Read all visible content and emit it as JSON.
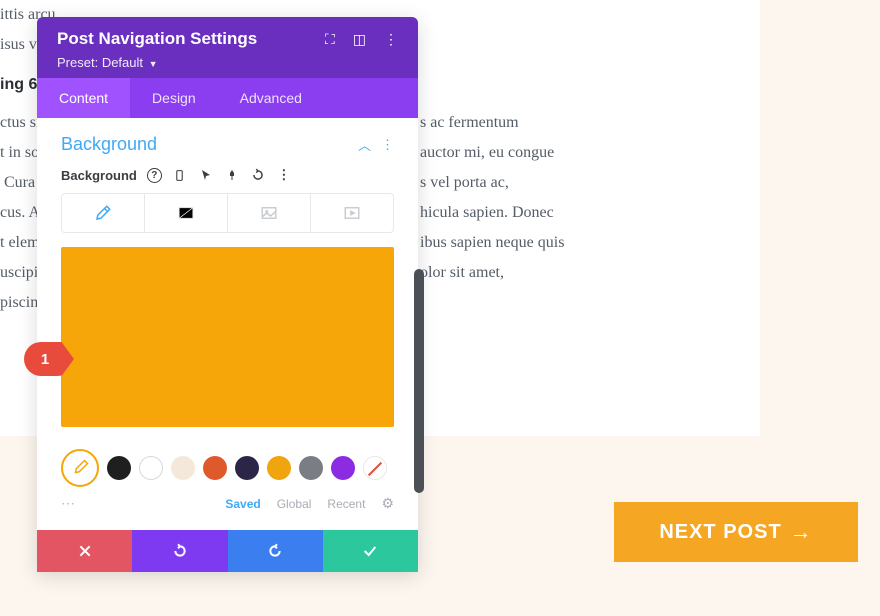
{
  "bg_text_top": "ittis arcu.\nisus velit",
  "bg_heading": "ing 6",
  "bg_text_body": "ctus sin\nt in so\n Cura\ncus. A\nt elem\nuscipi\npiscin",
  "bg_text_right": "s ac fermentum\nauctor mi, eu congue\ns vel porta ac,\nhicula sapien. Donec\nibus sapien neque quis\nolor sit amet,",
  "next_post": {
    "label": "NEXT POST",
    "arrow": "→"
  },
  "panel": {
    "title": "Post Navigation Settings",
    "preset_label": "Preset:",
    "preset_value": "Default",
    "tabs": [
      "Content",
      "Design",
      "Advanced"
    ],
    "section": {
      "title": "Background",
      "field_label": "Background",
      "preview_color": "#f6a609"
    },
    "swatches": [
      {
        "type": "picker"
      },
      {
        "color": "#1f1f1f"
      },
      {
        "color": "#ffffff",
        "outline": true
      },
      {
        "color": "#f4e8da"
      },
      {
        "color": "#df5a2a"
      },
      {
        "color": "#2b2547"
      },
      {
        "color": "#f0a40e"
      },
      {
        "color": "#7a7d83"
      },
      {
        "color": "#8b2be2"
      },
      {
        "type": "none"
      }
    ],
    "footer_links": {
      "saved": "Saved",
      "global": "Global",
      "recent": "Recent"
    }
  },
  "callout": "1"
}
